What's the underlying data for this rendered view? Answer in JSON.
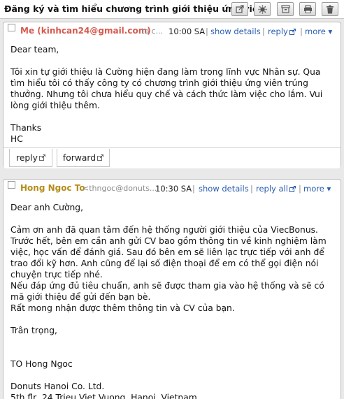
{
  "thread": {
    "subject": "Đăng ký và tìm hiểu chương trình giới thiệu ứng viên",
    "toolbar": [
      "popout-icon",
      "settings-icon",
      "archive-icon",
      "print-icon",
      "trash-icon"
    ]
  },
  "messages": [
    {
      "sender": "Me (kinhcan24@gmail.com)",
      "to": "to c...",
      "time": "10:00 SA",
      "show_details": "show details",
      "reply": "reply",
      "more": "more ▾",
      "body": [
        "Dear team,",
        "",
        "Tôi xin tự giới thiệu là Cường hiện đang làm trong lĩnh vực Nhân sự. Qua",
        "tìm hiểu tôi có thấy công ty có chương trình giới thiệu ứng viên trúng",
        "thưởng. Nhưng tôi chưa hiểu quy chế và cách thức làm việc cho lắm. Vui",
        "lòng giới thiệu thêm.",
        "",
        "Thanks",
        "HC"
      ],
      "actions": {
        "reply": "reply",
        "forward": "forward"
      }
    },
    {
      "sender": "Hong Ngoc To",
      "to": "<thngoc@donuts...",
      "time": "10:30 SA",
      "show_details": "show details",
      "reply": "reply all",
      "more": "more ▾",
      "body": [
        "Dear anh Cường,",
        "",
        "Cảm ơn anh đã quan tâm đến hệ thống người giới thiệu của ViecBonus.",
        "Trước hết, bên em cần anh gửi CV bao gồm thông tin về kinh nghiệm làm",
        "việc, học vấn để đánh giá. Sau đó bên em sẽ liên lạc trực tiếp với anh để",
        "trao đổi kỹ hơn. Anh cũng để lại số điện thoại để em có thể gọi điện nói",
        "chuyện trực tiếp nhé.",
        "Nếu đáp ứng đủ tiêu chuẩn, anh sẽ được tham gia vào hệ thống và sẽ có",
        "mã giới thiệu để gửi đến bạn bè.",
        "Rất mong nhận được thêm thông tin và CV của bạn.",
        "",
        "Trân trọng,",
        "",
        "",
        "TO Hong Ngoc",
        "",
        "Donuts Hanoi Co. Ltd.",
        "5th flr, 24 Trieu Viet Vuong, Hanoi, Vietnam"
      ]
    }
  ]
}
